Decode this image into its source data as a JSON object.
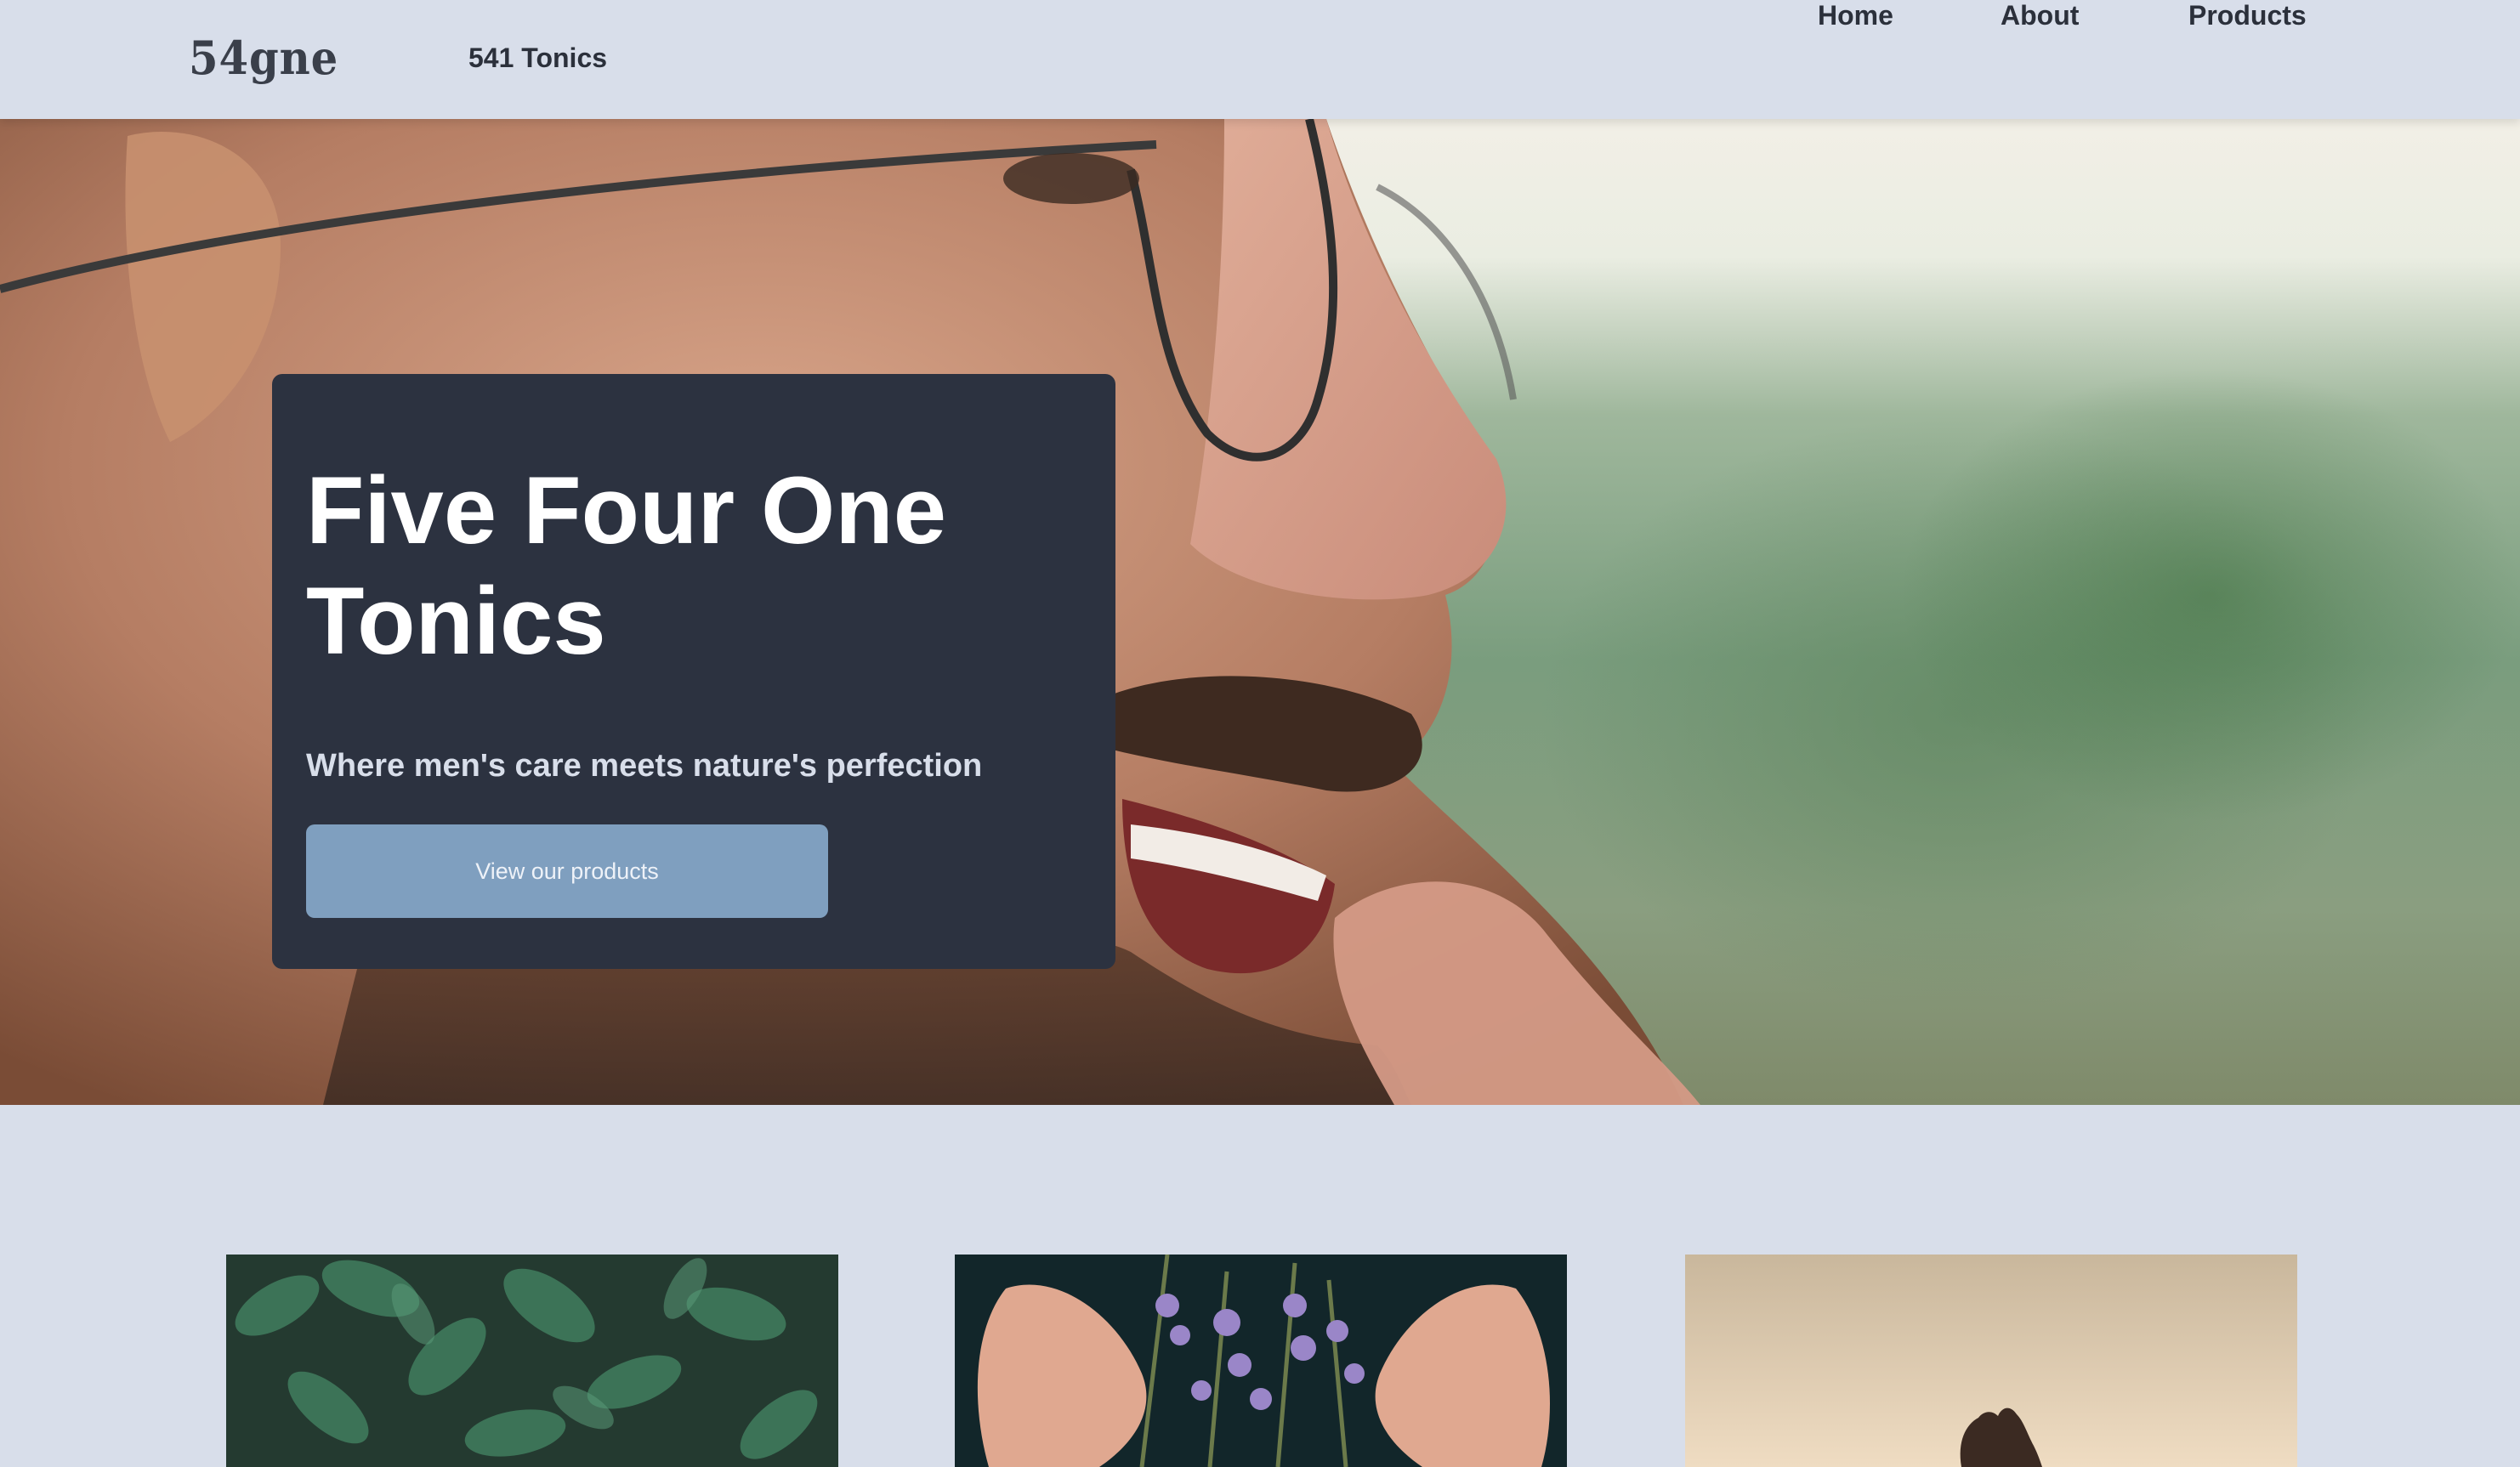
{
  "header": {
    "logo_text": "54gne",
    "brand_name": "541 Tonics",
    "nav": {
      "home": "Home",
      "about": "About",
      "products": "Products"
    }
  },
  "hero": {
    "title": "Five Four One Tonics",
    "subtitle": "Where men's care meets nature's perfection",
    "cta_label": "View our products",
    "image": "smiling-bearded-man-with-glasses-photo"
  },
  "features": [
    {
      "image": "green-leaves-photo"
    },
    {
      "image": "hands-holding-lavender-photo"
    },
    {
      "image": "hand-silhouette-sunset-photo"
    }
  ],
  "colors": {
    "background": "#d8deea",
    "card": "#2c3240",
    "button": "#7f9fbf",
    "text_dark": "#2b303b"
  }
}
